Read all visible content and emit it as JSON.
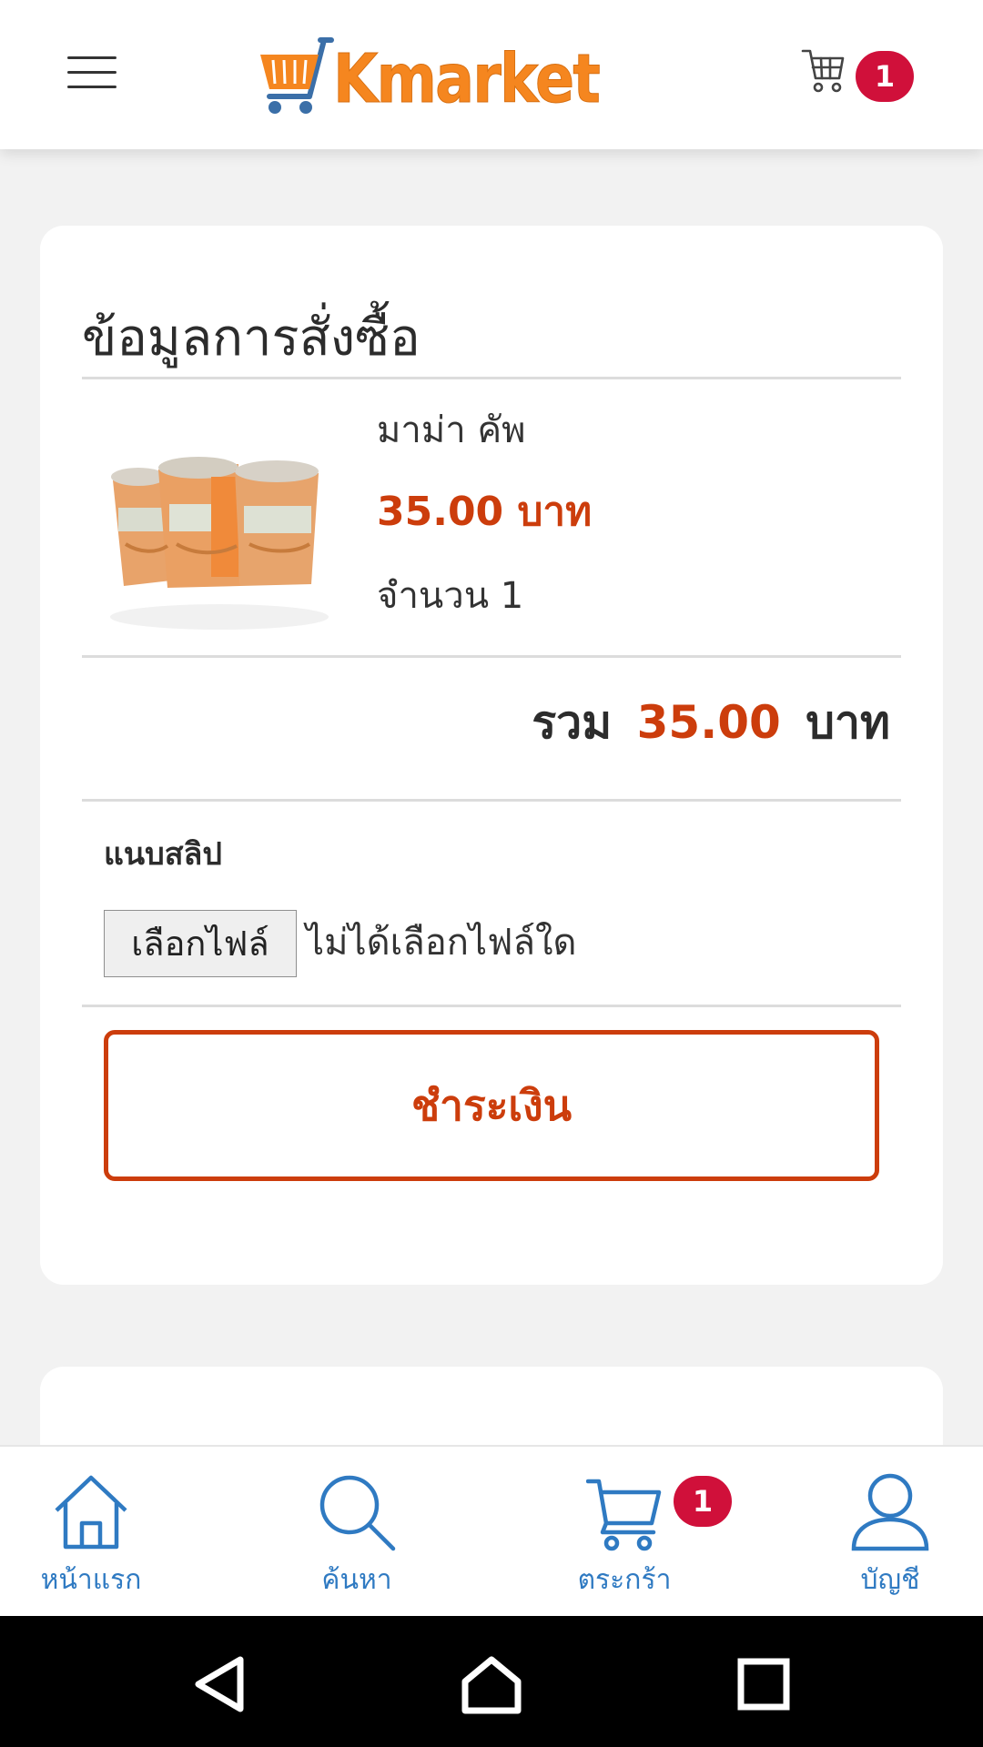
{
  "header": {
    "brand": "Kmarket",
    "cart_count": "1"
  },
  "order": {
    "title": "ข้อมูลการสั่งซื้อ",
    "item": {
      "name": "มาม่า คัพ",
      "price": "35.00 บาท",
      "quantity": "จำนวน 1"
    },
    "total_label": "รวม",
    "total_amount": "35.00",
    "total_unit": "บาท",
    "slip_label": "แนบสลิป",
    "file_button_label": "เลือกไฟล์",
    "file_status": "ไม่ได้เลือกไฟล์ใด",
    "pay_button_label": "ชำระเงิน"
  },
  "bottom_nav": {
    "items": [
      {
        "label": "หน้าแรก",
        "icon": "home-icon"
      },
      {
        "label": "ค้นหา",
        "icon": "search-icon"
      },
      {
        "label": "ตระกร้า",
        "icon": "cart-icon"
      },
      {
        "label": "บัญชี",
        "icon": "user-icon"
      }
    ],
    "cart_badge": "1"
  },
  "system_nav": {
    "icons": [
      "back-icon",
      "home-icon",
      "recents-icon"
    ]
  },
  "colors": {
    "brand_orange": "#f5861f",
    "price_red": "#cc3d0c",
    "badge_red": "#d0103a",
    "nav_blue": "#2f7ac2"
  }
}
